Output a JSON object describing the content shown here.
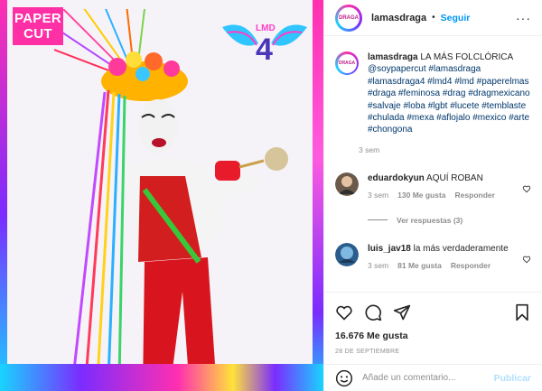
{
  "media": {
    "logo_left": "PAPER CUT",
    "logo_left_line1": "PAPER",
    "logo_left_line2": "CUT",
    "logo_right_text": "LMD",
    "logo_right_number": "4"
  },
  "header": {
    "username": "lamasdraga",
    "separator": "•",
    "follow_label": "Seguir",
    "more_label": "···",
    "avatar_text": "DRAGA"
  },
  "caption": {
    "username": "lamasdraga",
    "text_before": "LA MÁS FOLCLÓRICA",
    "mention": "@soypapercut",
    "hashtags": [
      "#lamasdraga",
      "#lamasdraga4",
      "#lmd4",
      "#lmd",
      "#paperelmas",
      "#draga",
      "#feminosa",
      "#drag",
      "#dragmexicano",
      "#salvaje",
      "#loba",
      "#lgbt",
      "#lucete",
      "#temblaste",
      "#chulada",
      "#mexa",
      "#aflojalo",
      "#mexico",
      "#arte",
      "#chongona"
    ],
    "time": "3 sem"
  },
  "comments": [
    {
      "username": "eduardokyun",
      "text": "AQUÍ ROBAN",
      "time": "3 sem",
      "likes": "130 Me gusta",
      "reply": "Responder",
      "view_replies": "Ver respuestas (3)"
    },
    {
      "username": "luis_jav18",
      "text": "la más verdaderamente",
      "time": "3 sem",
      "likes": "81 Me gusta",
      "reply": "Responder"
    }
  ],
  "actions": {
    "likes": "16.676 Me gusta",
    "date": "28 DE SEPTIEMBRE"
  },
  "add_comment": {
    "placeholder": "Añade un comentario...",
    "post_label": "Publicar"
  },
  "colors": {
    "link": "#0095f6",
    "hashtag": "#00376b",
    "muted": "#8e8e8e",
    "post_disabled": "#b2dffc",
    "brand_pink": "#ff2fa6"
  },
  "icons": [
    "heart-icon",
    "comment-icon",
    "share-icon",
    "bookmark-icon",
    "emoji-icon",
    "more-options-icon"
  ]
}
